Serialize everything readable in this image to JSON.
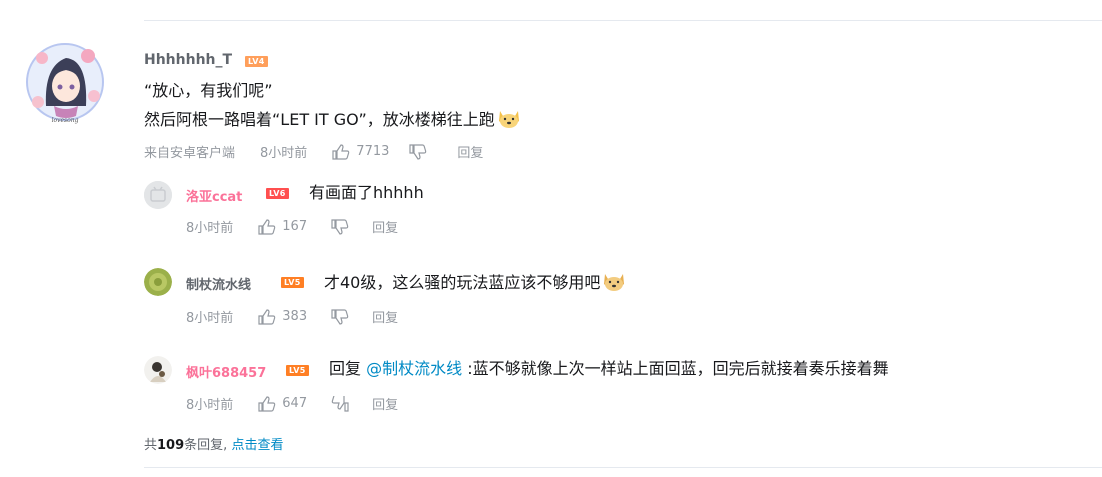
{
  "main_comment": {
    "username": "Hhhhhhh_T",
    "level": "LV4",
    "level_color": "#ff9f5b",
    "lines": [
      "“放心，有我们呢”",
      "然后阿根一路唱着“LET IT GO”，放冰楼梯往上跑"
    ],
    "source": "来自安卓客户端",
    "time": "8小时前",
    "likes": "7713",
    "reply_label": "回复"
  },
  "replies": [
    {
      "username": "洛亚ccat",
      "name_color": "#fb7299",
      "level": "LV6",
      "level_color": "#ff4f4f",
      "text": "有画面了hhhhh",
      "time": "8小时前",
      "likes": "167",
      "reply_label": "回复"
    },
    {
      "username": "制杖流水线",
      "name_color": "#61666d",
      "level": "LV5",
      "level_color": "#ff7f24",
      "text": "才40级，这么骚的玩法蓝应该不够用吧",
      "time": "8小时前",
      "likes": "383",
      "reply_label": "回复"
    },
    {
      "username": "枫叶688457",
      "name_color": "#fb7299",
      "level": "LV5",
      "level_color": "#ff7f24",
      "reply_prefix": "回复",
      "mention": "@制杖流水线",
      "text": ":蓝不够就像上次一样站上面回蓝，回完后就接着奏乐接着舞",
      "time": "8小时前",
      "likes": "647",
      "reply_label": "回复"
    }
  ],
  "more": {
    "prefix": "共",
    "count": "109",
    "suffix": "条回复,",
    "link": "点击查看"
  }
}
